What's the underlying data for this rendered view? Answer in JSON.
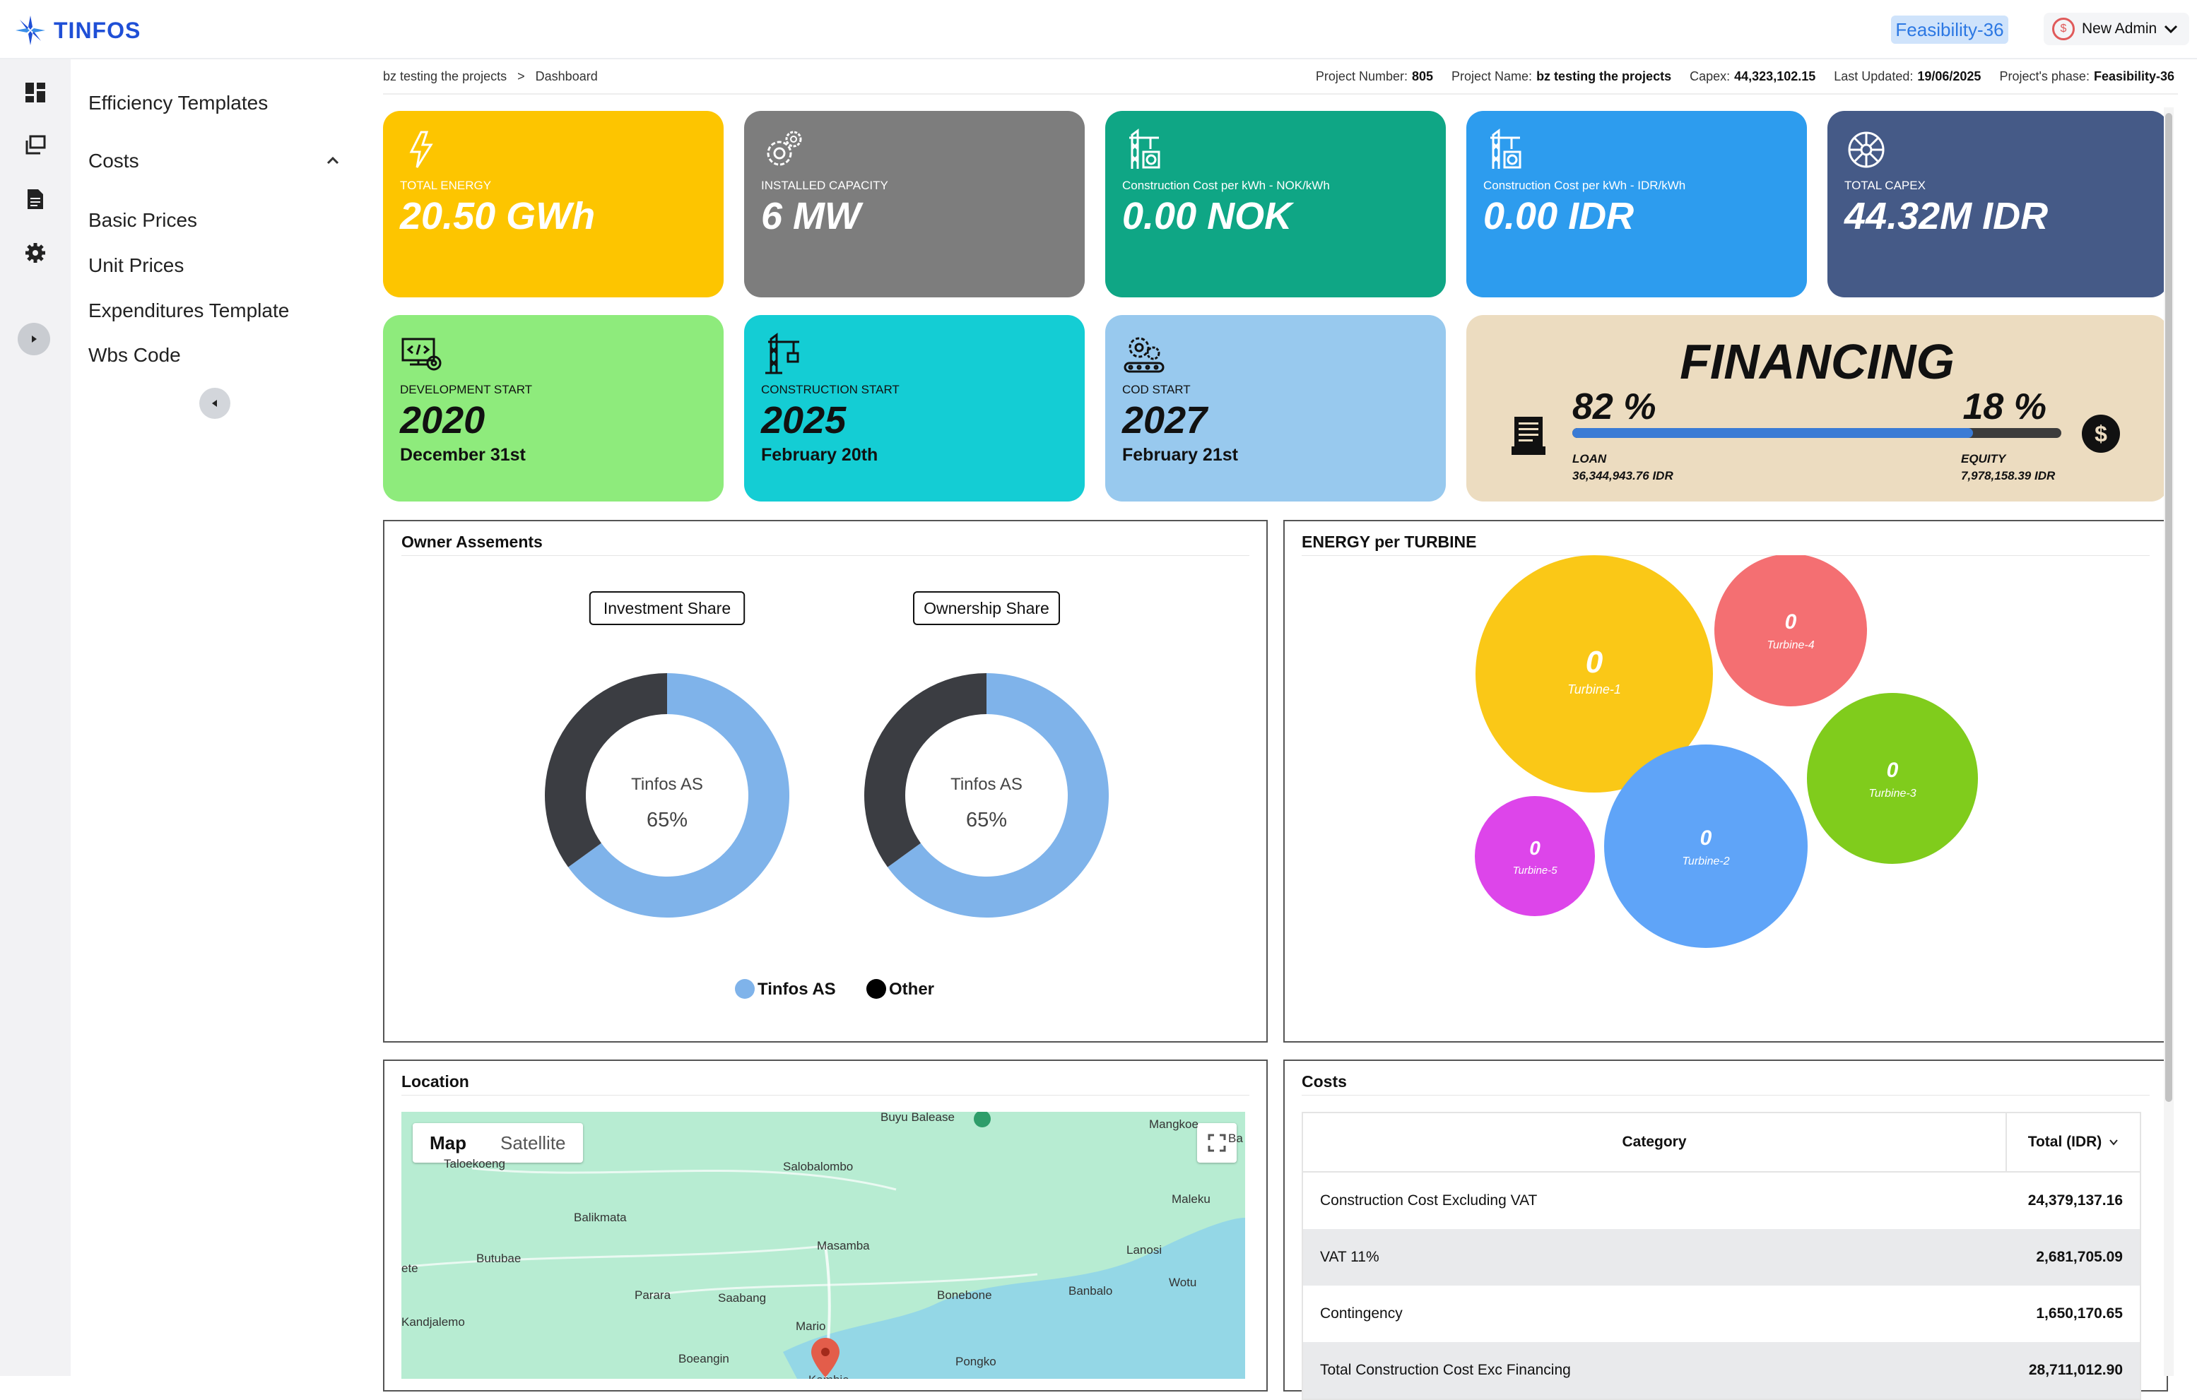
{
  "app": {
    "logo_text": "TINFOS",
    "phase_badge": "Feasibility-36",
    "user_name": "New Admin"
  },
  "sidebar": {
    "items": [
      {
        "label": "Efficiency Templates"
      },
      {
        "label": "Costs"
      },
      {
        "label": "Basic Prices"
      },
      {
        "label": "Unit Prices"
      },
      {
        "label": "Expenditures Template"
      },
      {
        "label": "Wbs Code"
      }
    ]
  },
  "breadcrumb": {
    "project": "bz testing the projects",
    "separator": ">",
    "page": "Dashboard"
  },
  "meta": {
    "project_number_label": "Project Number:",
    "project_number": "805",
    "project_name_label": "Project Name:",
    "project_name": "bz testing the projects",
    "capex_label": "Capex:",
    "capex": "44,323,102.15",
    "updated_label": "Last Updated:",
    "updated": "19/06/2025",
    "phase_label": "Project's phase:",
    "phase": "Feasibility-36"
  },
  "kpis": [
    {
      "label": "TOTAL ENERGY",
      "value": "20.50 GWh",
      "color": "#fdc500",
      "icon": "lightning-icon"
    },
    {
      "label": "INSTALLED CAPACITY",
      "value": "6 MW",
      "color": "#7d7d7d",
      "icon": "gears-icon"
    },
    {
      "label": "Construction Cost per kWh - NOK/kWh",
      "value": "0.00 NOK",
      "color": "#0fa685",
      "icon": "crane-icon"
    },
    {
      "label": "Construction Cost per kWh - IDR/kWh",
      "value": "0.00 IDR",
      "color": "#2d9cee",
      "icon": "crane-icon"
    },
    {
      "label": "TOTAL CAPEX",
      "value": "44.32M IDR",
      "color": "#455a87",
      "icon": "wheel-icon"
    }
  ],
  "milestones": [
    {
      "label": "DEVELOPMENT START",
      "year": "2020",
      "date": "December 31st",
      "color": "#8eeb7c",
      "icon": "code-monitor-icon"
    },
    {
      "label": "CONSTRUCTION START",
      "year": "2025",
      "date": "February 20th",
      "color": "#14cdd4",
      "icon": "crane-icon"
    },
    {
      "label": "COD START",
      "year": "2027",
      "date": "February 21st",
      "color": "#98c9ee",
      "icon": "gear-conveyor-icon"
    }
  ],
  "financing": {
    "title": "FINANCING",
    "loan_pct": "82 %",
    "equity_pct": "18 %",
    "loan_fraction": 0.82,
    "loan_label": "LOAN",
    "loan_value": "36,344,943.76 IDR",
    "equity_label": "EQUITY",
    "equity_value": "7,978,158.39 IDR",
    "bg_color": "#ecdcc0"
  },
  "owner_panel": {
    "title": "Owner Assements",
    "charts": [
      {
        "tag": "Investment Share",
        "center_name": "Tinfos AS",
        "center_value": "65%"
      },
      {
        "tag": "Ownership Share",
        "center_name": "Tinfos AS",
        "center_value": "65%"
      }
    ]
  },
  "energy_panel": {
    "title": "ENERGY per TURBINE"
  },
  "location_panel": {
    "title": "Location",
    "map_tab": "Map",
    "satellite_tab": "Satellite",
    "places": [
      "Buyu Balease",
      "Mangkoe",
      "Taloekoeng",
      "Salobalombo",
      "Balikmata",
      "Maleku",
      "Butubae",
      "Masamba",
      "Lanosi",
      "Parara",
      "Saabang",
      "Bonebone",
      "Banbalo",
      "Wotu",
      "Kandjalemo",
      "Mario",
      "Boeangin",
      "Pongko",
      "ete",
      "Ba",
      "Kambie"
    ]
  },
  "costs_panel": {
    "title": "Costs",
    "col_category": "Category",
    "col_total": "Total (IDR)",
    "rows": [
      {
        "category": "Construction Cost Excluding VAT",
        "total": "24,379,137.16"
      },
      {
        "category": "VAT 11%",
        "total": "2,681,705.09"
      },
      {
        "category": "Contingency",
        "total": "1,650,170.65"
      },
      {
        "category": "Total Construction Cost Exc Financing",
        "total": "28,711,012.90"
      }
    ]
  },
  "chart_data": [
    {
      "type": "pie",
      "title": "Investment Share",
      "categories": [
        "Tinfos AS",
        "Other"
      ],
      "values": [
        65,
        35
      ],
      "colors": [
        "#7fb3ea",
        "#3b3d42"
      ],
      "legend": "bottom"
    },
    {
      "type": "pie",
      "title": "Ownership Share",
      "categories": [
        "Tinfos AS",
        "Other"
      ],
      "values": [
        65,
        35
      ],
      "colors": [
        "#7fb3ea",
        "#3b3d42"
      ],
      "legend": "bottom"
    },
    {
      "type": "scatter",
      "title": "ENERGY per TURBINE",
      "categories": [
        "Turbine-1",
        "Turbine-4",
        "Turbine-3",
        "Turbine-5",
        "Turbine-2"
      ],
      "values": [
        0,
        0,
        0,
        0,
        0
      ],
      "colors": [
        "#fac817",
        "#f46f72",
        "#80cc1c",
        "#dd45ea",
        "#5fa4f8"
      ]
    }
  ]
}
